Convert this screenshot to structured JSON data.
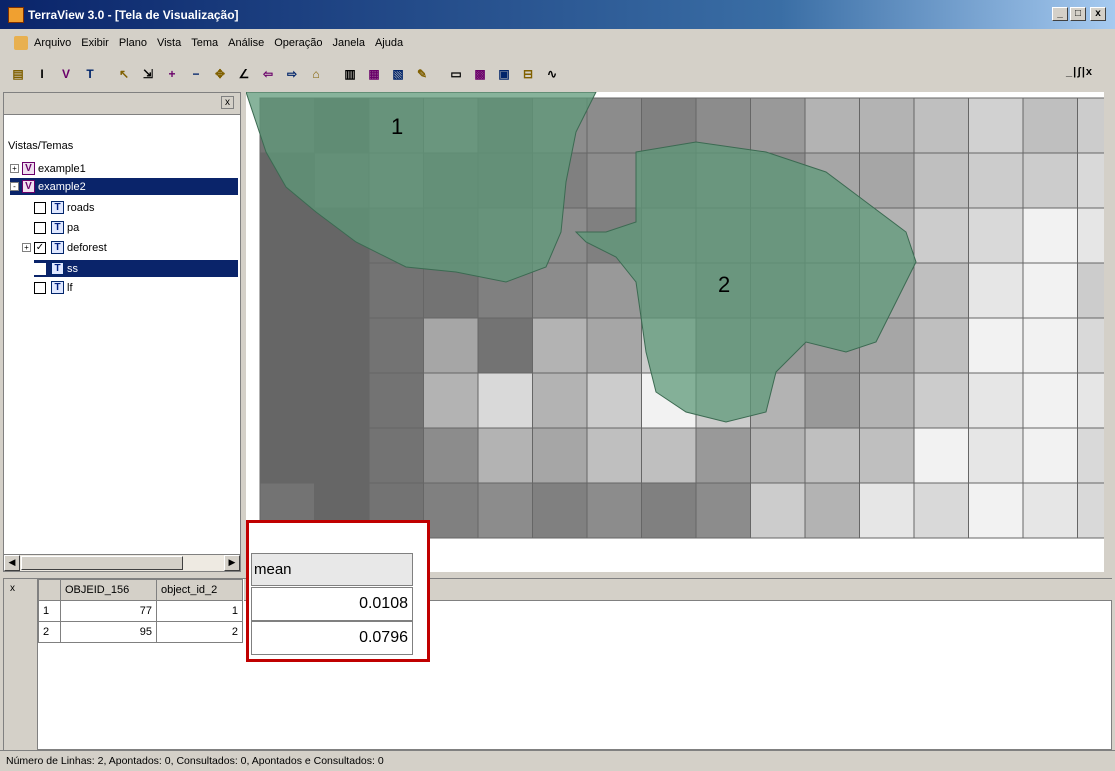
{
  "title": "TerraView 3.0 - [Tela de Visualização]",
  "window_buttons": [
    "_",
    "□",
    "x"
  ],
  "mdi_buttons": "_|ʃ|x",
  "menu": [
    "Arquivo",
    "Exibir",
    "Plano",
    "Vista",
    "Tema",
    "Análise",
    "Operação",
    "Janela",
    "Ajuda"
  ],
  "toolbar_icons": [
    "database-icon",
    "info-icon",
    "view-icon",
    "theme-icon",
    "pointer-icon",
    "zoom-area-icon",
    "zoom-in-icon",
    "zoom-out-icon",
    "pan-icon",
    "draw-icon",
    "back-icon",
    "forward-icon",
    "home-icon",
    "table-icon",
    "chart-icon",
    "query-icon",
    "edit-icon",
    "layout-icon",
    "grid-icon",
    "window-icon",
    "line-icon",
    "graph-icon"
  ],
  "tree": {
    "title": "Vistas/Temas",
    "views": [
      {
        "label": "example1"
      },
      {
        "label": "example2"
      }
    ],
    "themes": [
      {
        "label": "roads",
        "checked": false
      },
      {
        "label": "pa",
        "checked": false
      },
      {
        "label": "deforest",
        "checked": true
      },
      {
        "label": "ss",
        "checked": true
      },
      {
        "label": "lf",
        "checked": false
      }
    ]
  },
  "map": {
    "labels": [
      "1",
      "2"
    ],
    "fill_color": "#5f9a7a",
    "grid": [
      [
        0.45,
        0.4,
        0.5,
        0.55,
        0.45,
        0.55,
        0.55,
        0.5,
        0.55,
        0.6,
        0.7,
        0.7,
        0.75,
        0.82,
        0.75,
        0.8
      ],
      [
        0.4,
        0.45,
        0.5,
        0.45,
        0.45,
        0.5,
        0.55,
        0.5,
        0.55,
        0.55,
        0.65,
        0.65,
        0.75,
        0.8,
        0.8,
        0.85
      ],
      [
        0.4,
        0.4,
        0.45,
        0.45,
        0.5,
        0.55,
        0.5,
        0.55,
        0.55,
        0.55,
        0.6,
        0.7,
        0.8,
        0.85,
        0.95,
        0.9
      ],
      [
        0.4,
        0.4,
        0.45,
        0.45,
        0.5,
        0.55,
        0.6,
        0.6,
        0.55,
        0.55,
        0.6,
        0.65,
        0.75,
        0.9,
        0.95,
        0.8
      ],
      [
        0.4,
        0.4,
        0.45,
        0.65,
        0.45,
        0.7,
        0.65,
        0.8,
        0.6,
        0.6,
        0.6,
        0.65,
        0.75,
        0.95,
        0.95,
        0.85
      ],
      [
        0.4,
        0.4,
        0.45,
        0.7,
        0.85,
        0.7,
        0.8,
        0.95,
        0.8,
        0.7,
        0.6,
        0.7,
        0.8,
        0.9,
        0.95,
        0.9
      ],
      [
        0.4,
        0.4,
        0.45,
        0.55,
        0.7,
        0.65,
        0.75,
        0.75,
        0.6,
        0.7,
        0.75,
        0.75,
        0.95,
        0.9,
        0.95,
        0.85
      ],
      [
        0.45,
        0.4,
        0.45,
        0.5,
        0.55,
        0.5,
        0.55,
        0.5,
        0.55,
        0.8,
        0.7,
        0.9,
        0.85,
        0.95,
        0.9,
        0.85
      ]
    ]
  },
  "table": {
    "headers": [
      "OBJEID_156",
      "object_id_2"
    ],
    "rows": [
      {
        "n": "1",
        "objeid": "77",
        "object_id": "1"
      },
      {
        "n": "2",
        "objeid": "95",
        "object_id": "2"
      }
    ]
  },
  "mean": {
    "header": "mean",
    "values": [
      "0.0108",
      "0.0796"
    ],
    "highlight_color": "#c00000"
  },
  "status": "Número de Linhas: 2, Apontados: 0, Consultados: 0, Apontados e Consultados: 0"
}
